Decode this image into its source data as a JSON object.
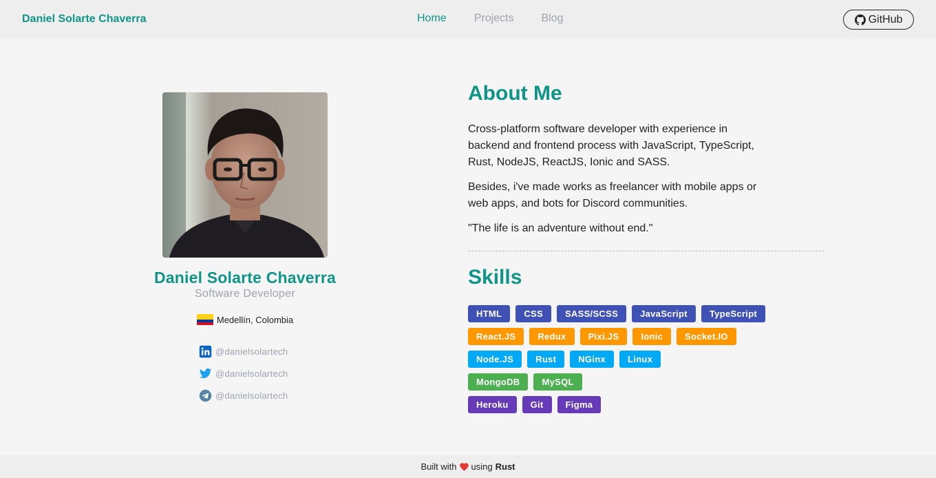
{
  "header": {
    "brand": "Daniel Solarte Chaverra",
    "nav": [
      {
        "label": "Home",
        "active": true
      },
      {
        "label": "Projects",
        "active": false
      },
      {
        "label": "Blog",
        "active": false
      }
    ],
    "github_label": "GitHub"
  },
  "profile": {
    "name": "Daniel Solarte Chaverra",
    "role": "Software Developer",
    "location": "Medellín, Colombia",
    "socials": [
      {
        "icon": "linkedin-icon",
        "handle": "@danielsolartech"
      },
      {
        "icon": "twitter-icon",
        "handle": "@danielsolartech"
      },
      {
        "icon": "telegram-icon",
        "handle": "@danielsolartech"
      }
    ]
  },
  "about": {
    "title": "About Me",
    "paragraph1": "Cross-platform software developer with experience in backend and frontend process with JavaScript, TypeScript, Rust, NodeJS, ReactJS, Ionic and SASS.",
    "paragraph2": "Besides, i've made works as freelancer with mobile apps or web apps, and bots for Discord communities.",
    "quote": "\"The life is an adventure without end.\""
  },
  "skills": {
    "title": "Skills",
    "groups": [
      {
        "color": "#3f51b5",
        "items": [
          "HTML",
          "CSS",
          "SASS/SCSS",
          "JavaScript",
          "TypeScript"
        ]
      },
      {
        "color": "#ff9800",
        "items": [
          "React.JS",
          "Redux",
          "Pixi.JS",
          "Ionic",
          "Socket.IO"
        ]
      },
      {
        "color": "#03a9f4",
        "items": [
          "Node.JS",
          "Rust",
          "NGinx",
          "Linux"
        ]
      },
      {
        "color": "#4caf50",
        "items": [
          "MongoDB",
          "MySQL"
        ]
      },
      {
        "color": "#673ab7",
        "items": [
          "Heroku",
          "Git",
          "Figma"
        ]
      }
    ]
  },
  "footer": {
    "prefix": "Built with",
    "middle": "using",
    "tech": "Rust"
  },
  "colors": {
    "accent": "#0f9488",
    "muted": "#9ca3af",
    "heart": "#e53935"
  }
}
